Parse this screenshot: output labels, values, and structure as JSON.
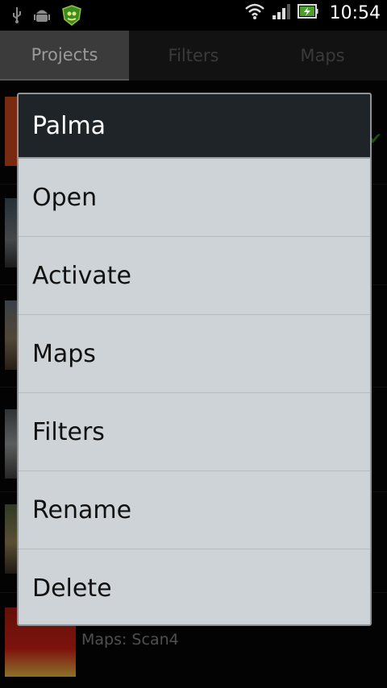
{
  "status_bar": {
    "time": "10:54",
    "icons": [
      "usb-icon",
      "android-debug-icon",
      "app-shield-icon",
      "wifi-icon",
      "signal-icon",
      "battery-charging-icon"
    ]
  },
  "tabs": [
    {
      "label": "Projects",
      "active": true
    },
    {
      "label": "Filters",
      "active": false
    },
    {
      "label": "Maps",
      "active": false
    }
  ],
  "background": {
    "visible_caption": "Maps: Scan4"
  },
  "dialog": {
    "title": "Palma",
    "items": [
      "Open",
      "Activate",
      "Maps",
      "Filters",
      "Rename",
      "Delete"
    ]
  },
  "colors": {
    "dialog_bg": "#cdd3d6",
    "dialog_title_bg": "#1e2427",
    "accent_green": "#3c8b22"
  }
}
